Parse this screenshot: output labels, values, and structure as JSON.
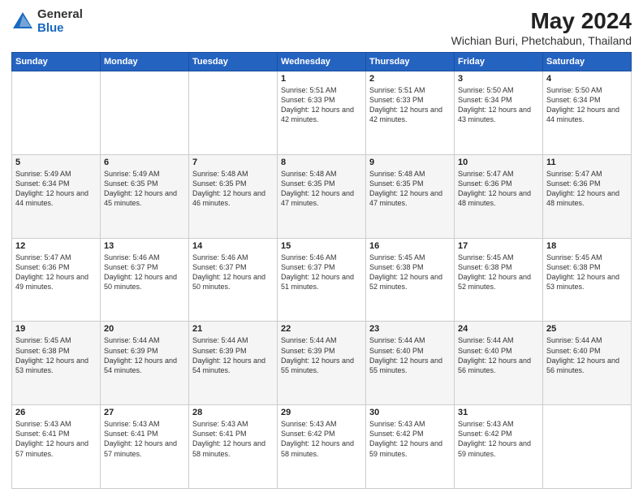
{
  "logo": {
    "general": "General",
    "blue": "Blue"
  },
  "title": "May 2024",
  "subtitle": "Wichian Buri, Phetchabun, Thailand",
  "days_of_week": [
    "Sunday",
    "Monday",
    "Tuesday",
    "Wednesday",
    "Thursday",
    "Friday",
    "Saturday"
  ],
  "weeks": [
    [
      {
        "day": "",
        "info": ""
      },
      {
        "day": "",
        "info": ""
      },
      {
        "day": "",
        "info": ""
      },
      {
        "day": "1",
        "info": "Sunrise: 5:51 AM\nSunset: 6:33 PM\nDaylight: 12 hours and 42 minutes."
      },
      {
        "day": "2",
        "info": "Sunrise: 5:51 AM\nSunset: 6:33 PM\nDaylight: 12 hours and 42 minutes."
      },
      {
        "day": "3",
        "info": "Sunrise: 5:50 AM\nSunset: 6:34 PM\nDaylight: 12 hours and 43 minutes."
      },
      {
        "day": "4",
        "info": "Sunrise: 5:50 AM\nSunset: 6:34 PM\nDaylight: 12 hours and 44 minutes."
      }
    ],
    [
      {
        "day": "5",
        "info": "Sunrise: 5:49 AM\nSunset: 6:34 PM\nDaylight: 12 hours and 44 minutes."
      },
      {
        "day": "6",
        "info": "Sunrise: 5:49 AM\nSunset: 6:35 PM\nDaylight: 12 hours and 45 minutes."
      },
      {
        "day": "7",
        "info": "Sunrise: 5:48 AM\nSunset: 6:35 PM\nDaylight: 12 hours and 46 minutes."
      },
      {
        "day": "8",
        "info": "Sunrise: 5:48 AM\nSunset: 6:35 PM\nDaylight: 12 hours and 47 minutes."
      },
      {
        "day": "9",
        "info": "Sunrise: 5:48 AM\nSunset: 6:35 PM\nDaylight: 12 hours and 47 minutes."
      },
      {
        "day": "10",
        "info": "Sunrise: 5:47 AM\nSunset: 6:36 PM\nDaylight: 12 hours and 48 minutes."
      },
      {
        "day": "11",
        "info": "Sunrise: 5:47 AM\nSunset: 6:36 PM\nDaylight: 12 hours and 48 minutes."
      }
    ],
    [
      {
        "day": "12",
        "info": "Sunrise: 5:47 AM\nSunset: 6:36 PM\nDaylight: 12 hours and 49 minutes."
      },
      {
        "day": "13",
        "info": "Sunrise: 5:46 AM\nSunset: 6:37 PM\nDaylight: 12 hours and 50 minutes."
      },
      {
        "day": "14",
        "info": "Sunrise: 5:46 AM\nSunset: 6:37 PM\nDaylight: 12 hours and 50 minutes."
      },
      {
        "day": "15",
        "info": "Sunrise: 5:46 AM\nSunset: 6:37 PM\nDaylight: 12 hours and 51 minutes."
      },
      {
        "day": "16",
        "info": "Sunrise: 5:45 AM\nSunset: 6:38 PM\nDaylight: 12 hours and 52 minutes."
      },
      {
        "day": "17",
        "info": "Sunrise: 5:45 AM\nSunset: 6:38 PM\nDaylight: 12 hours and 52 minutes."
      },
      {
        "day": "18",
        "info": "Sunrise: 5:45 AM\nSunset: 6:38 PM\nDaylight: 12 hours and 53 minutes."
      }
    ],
    [
      {
        "day": "19",
        "info": "Sunrise: 5:45 AM\nSunset: 6:38 PM\nDaylight: 12 hours and 53 minutes."
      },
      {
        "day": "20",
        "info": "Sunrise: 5:44 AM\nSunset: 6:39 PM\nDaylight: 12 hours and 54 minutes."
      },
      {
        "day": "21",
        "info": "Sunrise: 5:44 AM\nSunset: 6:39 PM\nDaylight: 12 hours and 54 minutes."
      },
      {
        "day": "22",
        "info": "Sunrise: 5:44 AM\nSunset: 6:39 PM\nDaylight: 12 hours and 55 minutes."
      },
      {
        "day": "23",
        "info": "Sunrise: 5:44 AM\nSunset: 6:40 PM\nDaylight: 12 hours and 55 minutes."
      },
      {
        "day": "24",
        "info": "Sunrise: 5:44 AM\nSunset: 6:40 PM\nDaylight: 12 hours and 56 minutes."
      },
      {
        "day": "25",
        "info": "Sunrise: 5:44 AM\nSunset: 6:40 PM\nDaylight: 12 hours and 56 minutes."
      }
    ],
    [
      {
        "day": "26",
        "info": "Sunrise: 5:43 AM\nSunset: 6:41 PM\nDaylight: 12 hours and 57 minutes."
      },
      {
        "day": "27",
        "info": "Sunrise: 5:43 AM\nSunset: 6:41 PM\nDaylight: 12 hours and 57 minutes."
      },
      {
        "day": "28",
        "info": "Sunrise: 5:43 AM\nSunset: 6:41 PM\nDaylight: 12 hours and 58 minutes."
      },
      {
        "day": "29",
        "info": "Sunrise: 5:43 AM\nSunset: 6:42 PM\nDaylight: 12 hours and 58 minutes."
      },
      {
        "day": "30",
        "info": "Sunrise: 5:43 AM\nSunset: 6:42 PM\nDaylight: 12 hours and 59 minutes."
      },
      {
        "day": "31",
        "info": "Sunrise: 5:43 AM\nSunset: 6:42 PM\nDaylight: 12 hours and 59 minutes."
      },
      {
        "day": "",
        "info": ""
      }
    ]
  ]
}
